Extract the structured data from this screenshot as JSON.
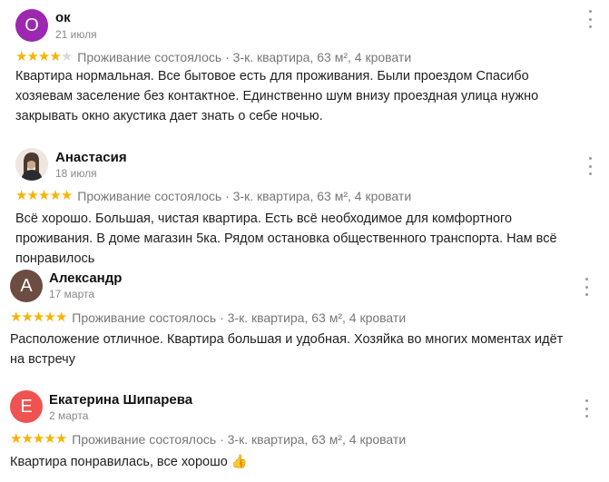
{
  "colors": {
    "star_filled": "#f6b400",
    "star_empty": "#d9d9d9",
    "avatar_purple": "#9c27b0",
    "avatar_brown": "#6d4c41",
    "avatar_red": "#ef5350"
  },
  "reviews": [
    {
      "author": "ок",
      "avatar_letter": "О",
      "date": "21 июля",
      "rating": 4,
      "meta": "Проживание состоялось · 3-к. квартира, 63 м², 4 кровати",
      "text": "Квартира нормальная. Все бытовое есть для проживания. Были проездом Спасибо хозяевам заселение без контактное. Единственно шум внизу проездная улица нужно закрывать окно акустика дает знать о себе ночью."
    },
    {
      "author": "Анастасия",
      "avatar_letter": "",
      "date": "18 июля",
      "rating": 5,
      "meta": "Проживание состоялось · 3-к. квартира, 63 м², 4 кровати",
      "text": "Всё хорошо. Большая, чистая квартира. Есть всё необходимое для комфортного проживания. В доме магазин 5ка. Рядом остановка общественного транспорта. Нам всё понравилось"
    },
    {
      "author": "Александр",
      "avatar_letter": "А",
      "date": "17 марта",
      "rating": 5,
      "meta": "Проживание состоялось · 3-к. квартира, 63 м², 4 кровати",
      "text": "Расположение отличное. Квартира большая и удобная. Хозяйка во многих моментах идёт на встречу"
    },
    {
      "author": "Екатерина Шипарева",
      "avatar_letter": "Е",
      "date": "2 марта",
      "rating": 5,
      "meta": "Проживание состоялось · 3-к. квартира, 63 м², 4 кровати",
      "text": "Квартира понравилась, все хорошо 👍"
    }
  ]
}
